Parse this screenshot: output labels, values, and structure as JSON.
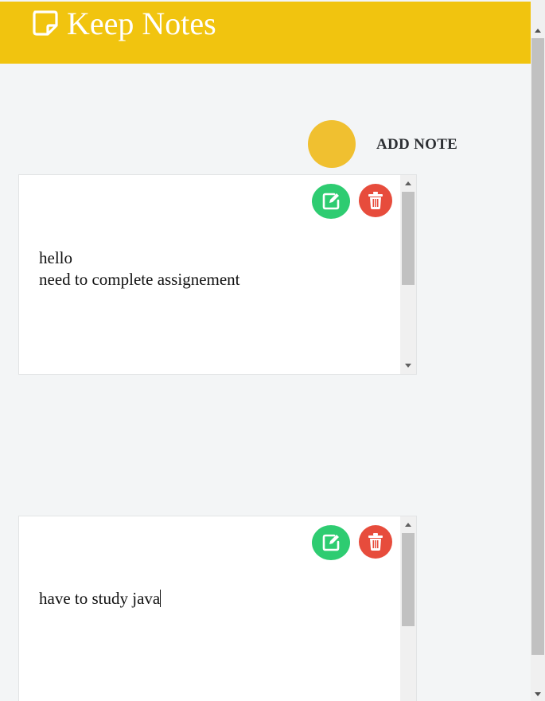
{
  "header": {
    "title": "Keep Notes",
    "logo_icon": "sticky-note-icon",
    "color": "#f1c40f"
  },
  "actions": {
    "add_note_label": "ADD NOTE",
    "add_circle_color": "#f0c030"
  },
  "notes": [
    {
      "text": "hello\nneed to complete assignement",
      "edit_icon": "edit-icon",
      "delete_icon": "trash-icon"
    },
    {
      "text": "have to study java",
      "edit_icon": "edit-icon",
      "delete_icon": "trash-icon"
    }
  ],
  "colors": {
    "edit": "#2ecc71",
    "delete": "#e74c3c",
    "background": "#f3f5f6"
  }
}
